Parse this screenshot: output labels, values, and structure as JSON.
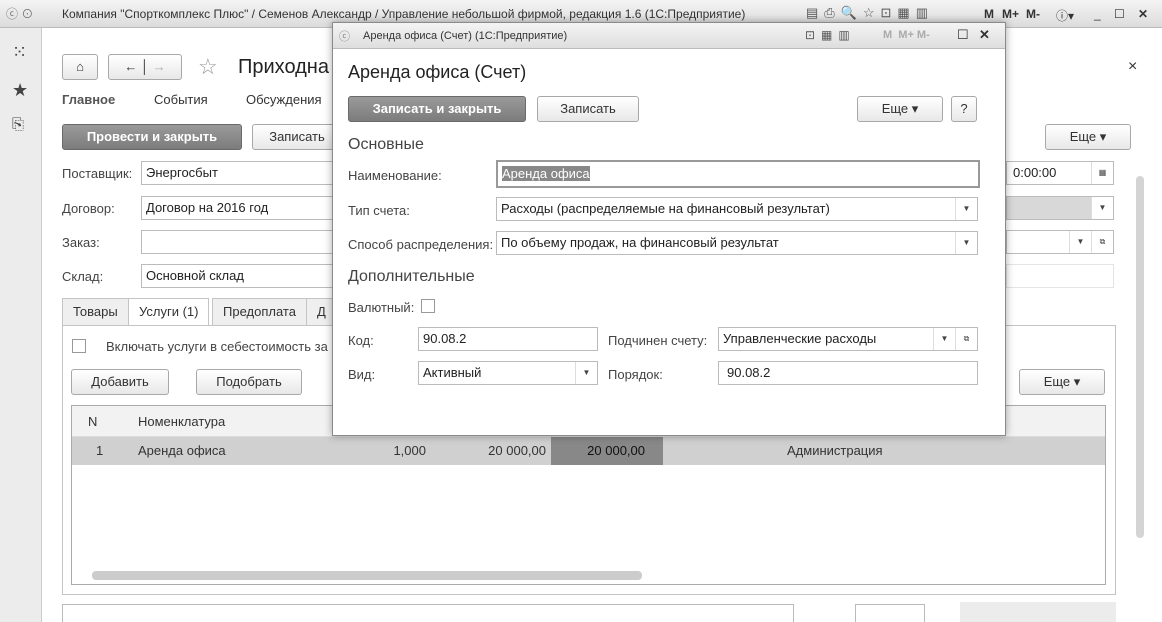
{
  "window": {
    "title": "Компания \"Спорткомплекс Плюс\" / Семенов Александр / Управление небольшой фирмой, редакция 1.6  (1С:Предприятие)",
    "toolbar_m": "M",
    "toolbar_mplus": "M+",
    "toolbar_mminus": "M-"
  },
  "document": {
    "title": "Приходна",
    "nav_tabs": [
      "Главное",
      "События",
      "Обсуждения"
    ],
    "post_close": "Провести и закрыть",
    "save": "Записать",
    "more": "Еще",
    "close": "×",
    "supplier_label": "Поставщик:",
    "supplier": "Энергосбыт",
    "contract_label": "Договор:",
    "contract": "Договор на 2016 год",
    "order_label": "Заказ:",
    "order": "",
    "warehouse_label": "Склад:",
    "warehouse": "Основной склад",
    "date_time": "0:00:00",
    "tabs": [
      "Товары",
      "Услуги (1)",
      "Предоплата",
      "Д"
    ],
    "include_services": "Включать услуги в себестоимость за",
    "add": "Добавить",
    "pick": "Подобрать",
    "table": {
      "headers": [
        "N",
        "Номенклатура"
      ],
      "rows": [
        {
          "n": "1",
          "name": "Аренда офиса",
          "qty": "1,000",
          "price": "20 000,00",
          "sum": "20 000,00",
          "dept": "Администрация"
        }
      ]
    }
  },
  "dialog": {
    "window_title": "Аренда офиса (Счет)  (1С:Предприятие)",
    "heading": "Аренда офиса (Счет)",
    "save_close": "Записать и закрыть",
    "save": "Записать",
    "more": "Еще",
    "help": "?",
    "section_main": "Основные",
    "name_label": "Наименование:",
    "name": "Аренда офиса",
    "type_label": "Тип счета:",
    "type": "Расходы (распределяемые на финансовый результат)",
    "dist_label": "Способ распределения:",
    "dist": "По объему продаж, на финансовый результат",
    "section_extra": "Дополнительные",
    "currency_label": "Валютный:",
    "code_label": "Код:",
    "code": "90.08.2",
    "parent_label": "Подчинен счету:",
    "parent": "Управленческие расходы",
    "kind_label": "Вид:",
    "kind": "Активный",
    "order_label": "Порядок:",
    "order": "90.08.2"
  }
}
